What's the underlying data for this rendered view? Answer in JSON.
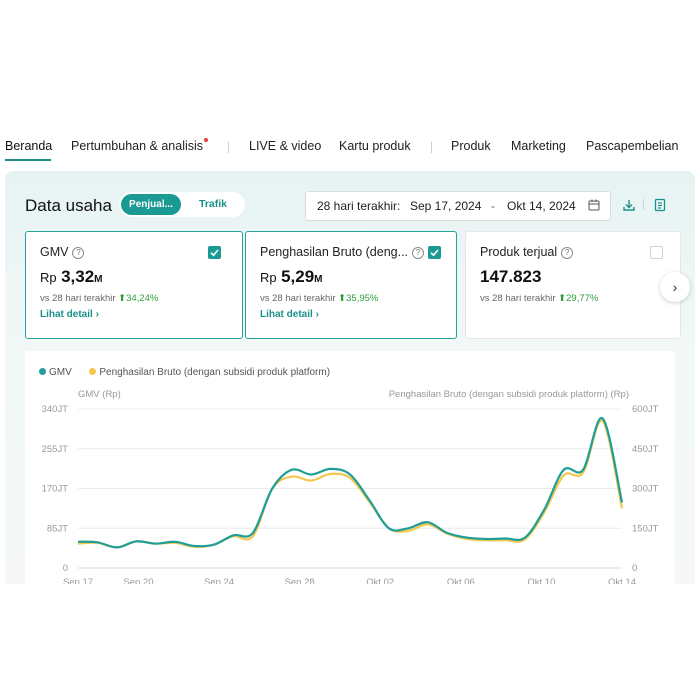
{
  "nav": {
    "items": [
      "Beranda",
      "Pertumbuhan & analisis",
      "LIVE & video",
      "Kartu produk",
      "Produk",
      "Marketing",
      "Pascapembelian"
    ],
    "active": "Beranda"
  },
  "panel": {
    "title": "Data usaha",
    "tabs": [
      "Penjual...",
      "Trafik"
    ],
    "active_tab": "Penjual...",
    "date_range": {
      "label": "28 hari terakhir:",
      "start": "Sep 17, 2024",
      "separator": "-",
      "end": "Okt 14, 2024"
    },
    "icons": [
      "download-icon",
      "report-icon",
      "calendar-icon"
    ]
  },
  "metrics": [
    {
      "title": "GMV",
      "currency": "Rp",
      "value": "3,32",
      "unit": "M",
      "compare_label": "vs 28 hari terakhir",
      "change": "34,24%",
      "link": "Lihat detail",
      "selected": true
    },
    {
      "title": "Penghasilan Bruto (deng...",
      "currency": "Rp",
      "value": "5,29",
      "unit": "M",
      "compare_label": "vs 28 hari terakhir",
      "change": "35,95%",
      "link": "Lihat detail",
      "selected": true
    },
    {
      "title": "Produk terjual",
      "currency": "",
      "value": "147.823",
      "unit": "",
      "compare_label": "vs 28 hari terakhir",
      "change": "29,77%",
      "link": "",
      "selected": false
    }
  ],
  "colors": {
    "accent": "#1b9a93",
    "gmv": "#1e9e97",
    "bruto": "#f4c64c",
    "positive": "#2f9e3a"
  },
  "chart_data": {
    "type": "line",
    "legend": [
      "GMV",
      "Penghasilan Bruto (dengan subsidi produk platform)"
    ],
    "left_axis_title": "GMV (Rp)",
    "right_axis_title": "Penghasilan Bruto (dengan subsidi produk platform) (Rp)",
    "left_ticks": [
      "0",
      "85JT",
      "170JT",
      "255JT",
      "340JT"
    ],
    "right_ticks": [
      "0",
      "150JT",
      "300JT",
      "450JT",
      "600JT"
    ],
    "left_range": [
      0,
      340
    ],
    "right_range": [
      0,
      600
    ],
    "x_ticks": [
      "Sep 17",
      "Sep 20",
      "Sep 24",
      "Sep 28",
      "Okt 02",
      "Okt 06",
      "Okt 10",
      "Okt 14"
    ],
    "x": [
      "Sep 17",
      "Sep 18",
      "Sep 19",
      "Sep 20",
      "Sep 21",
      "Sep 22",
      "Sep 23",
      "Sep 24",
      "Sep 25",
      "Sep 26",
      "Sep 27",
      "Sep 28",
      "Sep 29",
      "Sep 30",
      "Okt 01",
      "Okt 02",
      "Okt 03",
      "Okt 04",
      "Okt 05",
      "Okt 06",
      "Okt 07",
      "Okt 08",
      "Okt 09",
      "Okt 10",
      "Okt 11",
      "Okt 12",
      "Okt 13",
      "Okt 14"
    ],
    "series": [
      {
        "name": "GMV",
        "axis": "left",
        "values": [
          56,
          55,
          44,
          57,
          52,
          56,
          47,
          50,
          70,
          75,
          170,
          210,
          200,
          212,
          200,
          145,
          85,
          85,
          98,
          75,
          65,
          62,
          63,
          65,
          125,
          210,
          210,
          320,
          140
        ]
      },
      {
        "name": "Penghasilan Bruto (dengan subsidi produk platform)",
        "axis": "right",
        "values": [
          92,
          95,
          78,
          100,
          92,
          95,
          80,
          88,
          120,
          120,
          300,
          345,
          330,
          355,
          340,
          250,
          150,
          140,
          165,
          130,
          110,
          105,
          105,
          108,
          210,
          350,
          360,
          555,
          225
        ]
      }
    ]
  }
}
